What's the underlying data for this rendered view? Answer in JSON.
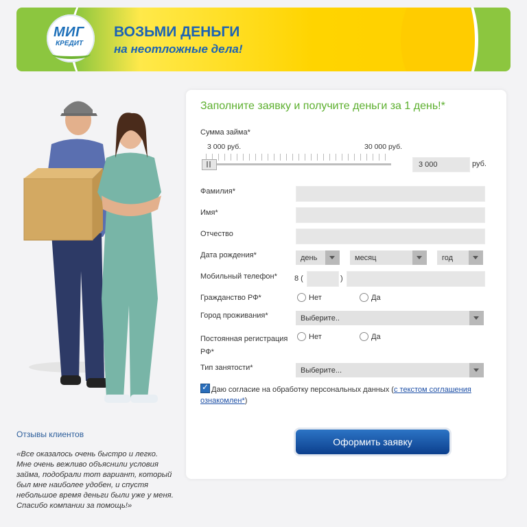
{
  "banner": {
    "logo_top": "МИГ",
    "logo_bottom": "КРЕДИТ",
    "title": "ВОЗЬМИ ДЕНЬГИ",
    "subtitle": "на неотложные дела!"
  },
  "reviews": {
    "title": "Отзывы клиентов",
    "text": "«Все оказалось очень быстро и легко. Мне очень вежливо объяснили условия займа, подобрали тот вариант, который был мне наиболее удобен, и спустя небольшое время деньги были уже у меня. Спасибо компании за помощь!»"
  },
  "form": {
    "title": "Заполните заявку и получите деньги за 1 день!*",
    "amount_label": "Сумма займа*",
    "slider_min_label": "3 000 руб.",
    "slider_max_label": "30 000 руб.",
    "slider_level": 0.0,
    "amount_value": "3 000",
    "amount_unit": "руб.",
    "surname_label": "Фамилия*",
    "name_label": "Имя*",
    "patronymic_label": "Отчество",
    "birthdate_label": "Дата рождения*",
    "day_value": "день",
    "month_value": "месяц",
    "year_value": "год",
    "phone_label": "Мобильный телефон*",
    "phone_prefix": "8 (",
    "phone_close": ")",
    "citizenship_label": "Гражданство РФ*",
    "no_label": "Нет",
    "yes_label": "Да",
    "city_label": "Город проживания*",
    "city_value": "Выберите..",
    "registration_label": "Постоянная регистрация РФ*",
    "employment_label": "Тип занятости*",
    "employment_value": "Выберите...",
    "consent_text": "Даю согласие на обработку персональных данных (",
    "consent_link": "с текстом соглашения ознакомлен*",
    "consent_end": ")",
    "consent_checked": true,
    "submit_label": "Оформить заявку"
  }
}
